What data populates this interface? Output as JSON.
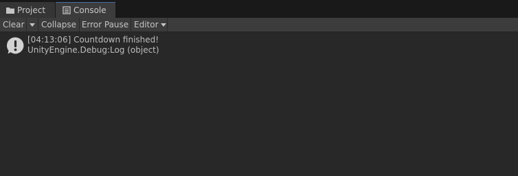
{
  "tabs": [
    {
      "label": "Project",
      "icon": "folder-icon"
    },
    {
      "label": "Console",
      "icon": "console-icon"
    }
  ],
  "toolbar": {
    "clear_label": "Clear",
    "collapse_label": "Collapse",
    "error_pause_label": "Error Pause",
    "editor_label": "Editor"
  },
  "log": {
    "entries": [
      {
        "icon": "info-icon",
        "message": "[04:13:06] Countdown finished!",
        "detail": "UnityEngine.Debug:Log (object)"
      }
    ]
  },
  "colors": {
    "background": "#282828",
    "tabbar": "#191919",
    "toolbar": "#3c3c3c",
    "active_tab_accent": "#4a6ea6",
    "text": "#c4c4c4"
  }
}
